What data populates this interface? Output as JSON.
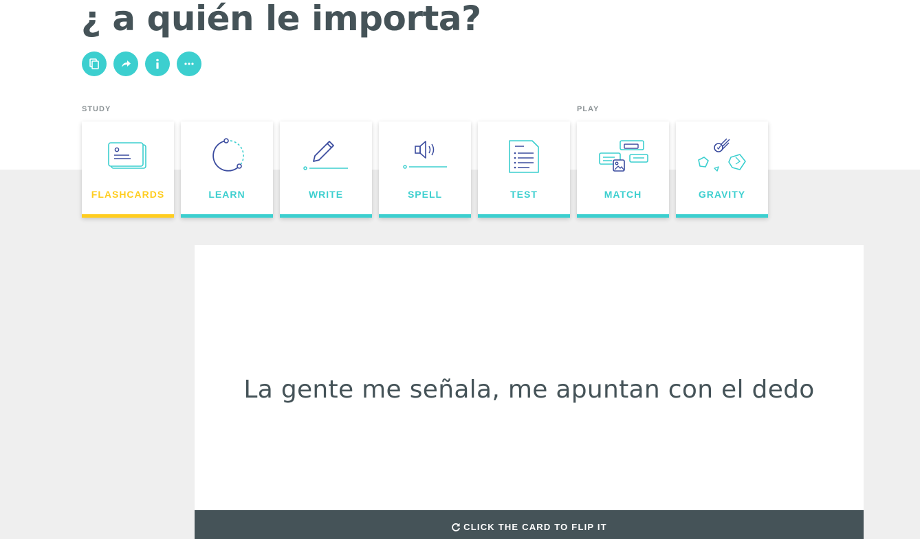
{
  "set": {
    "title": "¿ a quién le importa?"
  },
  "actions": [
    {
      "icon": "copy-icon"
    },
    {
      "icon": "share-icon"
    },
    {
      "icon": "info-icon"
    },
    {
      "icon": "more-icon"
    }
  ],
  "sections": {
    "study": "STUDY",
    "play": "PLAY"
  },
  "modes": [
    {
      "label": "FLASHCARDS",
      "icon": "flashcards-icon",
      "active": true
    },
    {
      "label": "LEARN",
      "icon": "learn-icon",
      "active": false
    },
    {
      "label": "WRITE",
      "icon": "write-icon",
      "active": false
    },
    {
      "label": "SPELL",
      "icon": "spell-icon",
      "active": false
    },
    {
      "label": "TEST",
      "icon": "test-icon",
      "active": false
    },
    {
      "label": "MATCH",
      "icon": "match-icon",
      "active": false
    },
    {
      "label": "GRAVITY",
      "icon": "gravity-icon",
      "active": false
    }
  ],
  "card": {
    "front_text": "La gente me señala, me apuntan con el dedo",
    "flip_hint": "CLICK THE CARD TO FLIP IT",
    "flip_icon": "refresh-icon"
  },
  "colors": {
    "accent": "#3ccfcf",
    "active": "#ffcd1f",
    "dark": "#455358",
    "navy": "#3a4b9e",
    "background": "#efefef"
  }
}
